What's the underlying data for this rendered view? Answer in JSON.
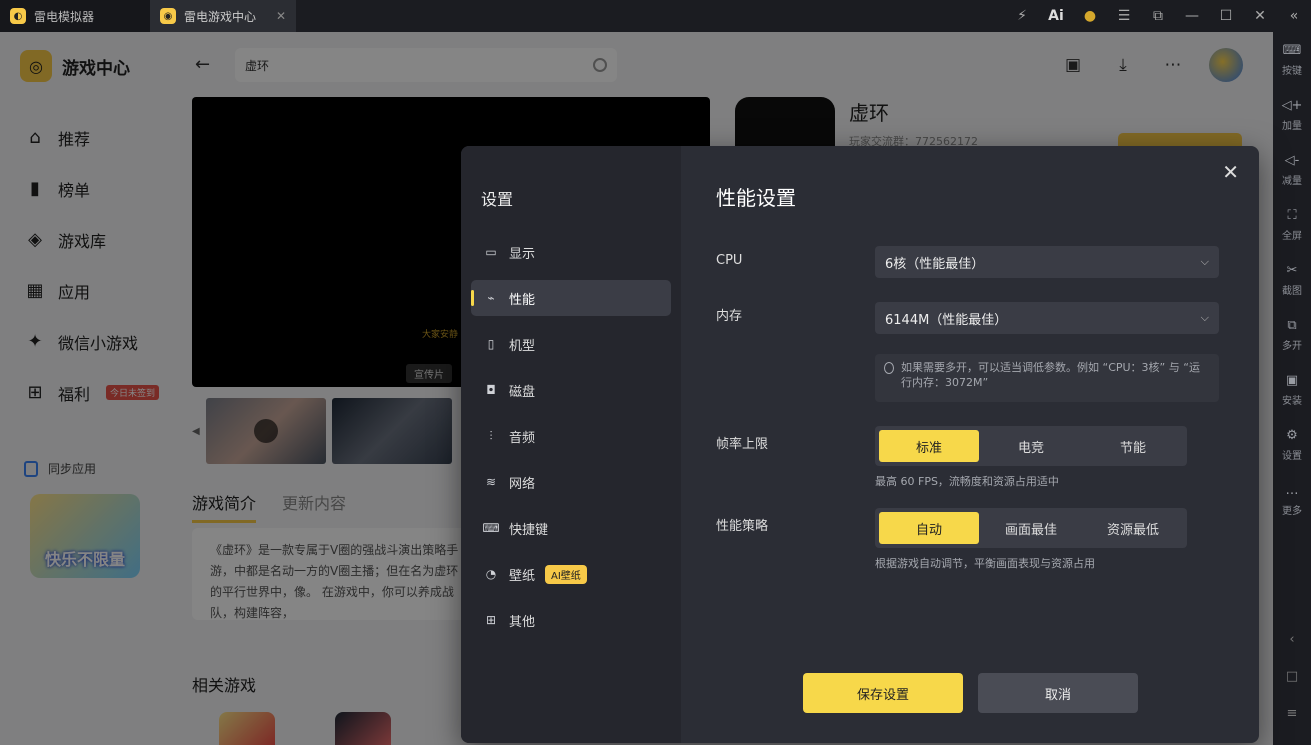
{
  "titlebar": {
    "tabs": [
      {
        "label": "雷电模拟器"
      },
      {
        "label": "雷电游戏中心"
      }
    ],
    "buttons": [
      "⚡",
      "Ai",
      "●",
      "☰",
      "⧉",
      "—",
      "☐",
      "✕",
      "«"
    ]
  },
  "sidebar": {
    "brand": "游戏中心",
    "items": [
      {
        "label": "推荐",
        "icon": "home-icon"
      },
      {
        "label": "榜单",
        "icon": "chart-icon"
      },
      {
        "label": "游戏库",
        "icon": "gamepad-icon"
      },
      {
        "label": "应用",
        "icon": "apps-icon"
      },
      {
        "label": "微信小游戏",
        "icon": "wechat-games-icon"
      },
      {
        "label": "福利",
        "icon": "gift-icon",
        "badge": "今日未签到"
      }
    ],
    "sync_label": "同步应用",
    "promo_text": "快乐不限量"
  },
  "main": {
    "search_value": "虚环",
    "video_label": "宣传片",
    "video_caption": "大家安静",
    "tabs": [
      "游戏简介",
      "更新内容"
    ],
    "description": "《虚环》是一款专属于V圈的强战斗演出策略手游，中都是名动一方的V圈主播；但在名为虚环的平行世界中，像。 在游戏中，你可以养成战队，构建阵容，",
    "related_title": "相关游戏",
    "game": {
      "title": "虚环",
      "group": "玩家交流群：772562172"
    }
  },
  "right_toolbar": [
    {
      "label": "按键",
      "icon": "keyboard-icon"
    },
    {
      "label": "加量",
      "icon": "volume-up-icon"
    },
    {
      "label": "减量",
      "icon": "volume-down-icon"
    },
    {
      "label": "全屏",
      "icon": "fullscreen-icon"
    },
    {
      "label": "截图",
      "icon": "scissors-icon"
    },
    {
      "label": "多开",
      "icon": "multi-open-icon"
    },
    {
      "label": "安装",
      "icon": "apk-install-icon"
    },
    {
      "label": "设置",
      "icon": "settings-icon"
    },
    {
      "label": "更多",
      "icon": "more-icon"
    }
  ],
  "modal": {
    "title": "设置",
    "menu": [
      {
        "label": "显示",
        "icon": "monitor-icon"
      },
      {
        "label": "性能",
        "icon": "performance-icon"
      },
      {
        "label": "机型",
        "icon": "phone-icon"
      },
      {
        "label": "磁盘",
        "icon": "disk-icon"
      },
      {
        "label": "音频",
        "icon": "audio-icon"
      },
      {
        "label": "网络",
        "icon": "wifi-icon"
      },
      {
        "label": "快捷键",
        "icon": "keyboard-icon"
      },
      {
        "label": "壁纸",
        "icon": "palette-icon",
        "badge": "AI壁纸"
      },
      {
        "label": "其他",
        "icon": "grid-icon"
      }
    ],
    "active_index": 1,
    "heading": "性能设置",
    "cpu": {
      "label": "CPU",
      "value": "6核（性能最佳）"
    },
    "memory": {
      "label": "内存",
      "value": "6144M（性能最佳）"
    },
    "memory_hint": "如果需要多开，可以适当调低参数。例如 “CPU：3核” 与 “运行内存：3072M”",
    "framerate": {
      "label": "帧率上限",
      "options": [
        "标准",
        "电竞",
        "节能"
      ],
      "selected": 0,
      "hint": "最高 60 FPS，流畅度和资源占用适中"
    },
    "strategy": {
      "label": "性能策略",
      "options": [
        "自动",
        "画面最佳",
        "资源最低"
      ],
      "selected": 0,
      "hint": "根据游戏自动调节，平衡画面表现与资源占用"
    },
    "save_label": "保存设置",
    "cancel_label": "取消"
  },
  "colors": {
    "accent": "#f7d84a",
    "modal_bg": "#2b2d35",
    "modal_side_bg": "#25262d"
  }
}
